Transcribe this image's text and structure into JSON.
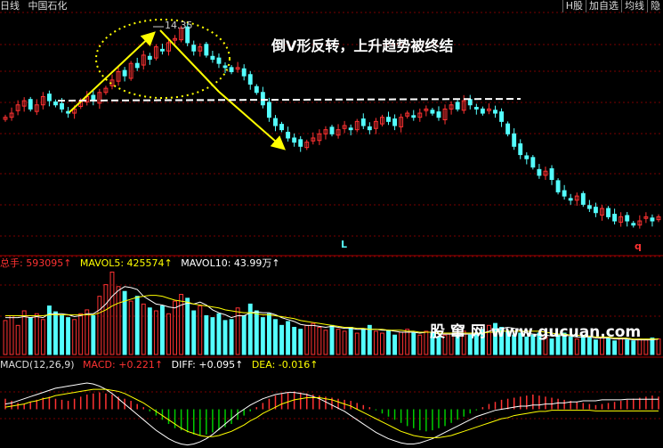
{
  "header": {
    "period": "日线",
    "stock_name": "中国石化"
  },
  "top_buttons": [
    {
      "label": "H股"
    },
    {
      "label": "加自选"
    },
    {
      "label": "均线"
    },
    {
      "label": "隐"
    }
  ],
  "annotation": {
    "title": "倒V形反转，上升趋势被终结",
    "watermark": "股 窜 网 www.gucuan.com",
    "peak_label": "14.35",
    "marker_l": "L",
    "marker_q": "q"
  },
  "volume_legend": {
    "total_label": "总手: 593095↑",
    "mavol5_label": "MAVOL5: 425574↑",
    "mavol10_label": "MAVOL10: 43.99万↑"
  },
  "macd_legend": {
    "params_label": "MACD(12,26,9)",
    "macd_label": "MACD: +0.221↑",
    "diff_label": "DIFF: +0.095↑",
    "dea_label": "DEA: -0.016↑"
  },
  "colors": {
    "up": "#ff3232",
    "down": "#54ffff",
    "grid": "#7a0000",
    "arrow": "#ffff00",
    "dashed_line": "#ffffff",
    "macd_pos": "#ff3232",
    "macd_neg": "#00cc00",
    "diff_line": "#ffffff",
    "dea_line": "#ffff00",
    "mavol5": "#ffffff",
    "mavol10": "#ffff00",
    "accent_label": "#ffff00"
  },
  "chart_data": [
    {
      "type": "candlestick",
      "peak_price": 14.35,
      "close": [
        12.2,
        12.3,
        12.5,
        12.6,
        12.4,
        12.5,
        12.7,
        12.6,
        12.5,
        12.4,
        12.3,
        12.4,
        12.6,
        12.7,
        12.6,
        12.8,
        12.9,
        13.1,
        13.3,
        13.2,
        13.5,
        13.4,
        13.7,
        13.6,
        13.9,
        13.8,
        14.0,
        14.1,
        14.35,
        14.0,
        13.8,
        13.9,
        13.7,
        13.6,
        13.5,
        13.4,
        13.3,
        13.4,
        13.2,
        13.0,
        12.8,
        12.5,
        12.2,
        12.0,
        11.9,
        11.7,
        11.6,
        11.5,
        11.6,
        11.7,
        11.8,
        11.9,
        11.8,
        11.9,
        12.0,
        11.9,
        12.1,
        12.0,
        11.9,
        12.1,
        12.2,
        12.1,
        12.0,
        12.2,
        12.3,
        12.2,
        12.3,
        12.4,
        12.3,
        12.2,
        12.4,
        12.5,
        12.4,
        12.6,
        12.5,
        12.4,
        12.3,
        12.4,
        12.3,
        12.1,
        11.8,
        11.5,
        11.3,
        11.2,
        11.0,
        10.8,
        10.9,
        10.7,
        10.4,
        10.3,
        10.2,
        10.3,
        10.1,
        10.0,
        9.9,
        10.0,
        9.8,
        9.7,
        9.8,
        9.7,
        9.6,
        9.7,
        9.8,
        9.7,
        9.8
      ]
    },
    {
      "type": "bar",
      "title": "总手",
      "values": [
        35,
        40,
        30,
        45,
        38,
        42,
        36,
        50,
        44,
        40,
        38,
        36,
        42,
        46,
        40,
        60,
        72,
        85,
        70,
        65,
        55,
        60,
        52,
        48,
        45,
        50,
        42,
        55,
        62,
        58,
        45,
        50,
        40,
        38,
        42,
        35,
        36,
        48,
        40,
        52,
        45,
        38,
        42,
        36,
        30,
        34,
        28,
        26,
        30,
        32,
        28,
        25,
        30,
        26,
        24,
        28,
        22,
        26,
        30,
        24,
        22,
        25,
        20,
        23,
        26,
        22,
        20,
        24,
        22,
        18,
        20,
        22,
        19,
        24,
        20,
        22,
        26,
        30,
        32,
        28,
        24,
        20,
        22,
        18,
        20,
        22,
        18,
        16,
        20,
        22,
        18,
        16,
        19,
        17,
        15,
        18,
        16,
        14,
        17,
        15,
        14,
        16,
        15,
        17,
        16
      ],
      "series": [
        {
          "name": "MAVOL5",
          "values": [
            38,
            38,
            38,
            39,
            38,
            39,
            38,
            42,
            42,
            42,
            41,
            39,
            40,
            42,
            42,
            46,
            52,
            60,
            66,
            70,
            69,
            67,
            60,
            56,
            52,
            51,
            49,
            48,
            51,
            53,
            52,
            54,
            51,
            46,
            43,
            41,
            38,
            40,
            40,
            43,
            44,
            43,
            43,
            41,
            38,
            36,
            34,
            31,
            30,
            30,
            29,
            28,
            29,
            28,
            27,
            27,
            26,
            26,
            26,
            26,
            25,
            25,
            24,
            23,
            23,
            23,
            22,
            23,
            23,
            21,
            21,
            21,
            20,
            21,
            21,
            21,
            22,
            24,
            26,
            27,
            28,
            27,
            25,
            22,
            21,
            20,
            20,
            19,
            19,
            20,
            19,
            18,
            18,
            18,
            17,
            17,
            17,
            16,
            16,
            16,
            15,
            15,
            15,
            15,
            16
          ]
        },
        {
          "name": "MAVOL10",
          "values": [
            40,
            40,
            40,
            40,
            40,
            40,
            40,
            41,
            41,
            41,
            41,
            41,
            41,
            41,
            41,
            43,
            46,
            50,
            53,
            55,
            57,
            59,
            60,
            61,
            61,
            60,
            58,
            56,
            55,
            54,
            52,
            51,
            50,
            49,
            48,
            46,
            45,
            44,
            43,
            43,
            42,
            41,
            41,
            40,
            39,
            38,
            37,
            35,
            34,
            33,
            32,
            31,
            30,
            29,
            28,
            28,
            27,
            27,
            26,
            26,
            26,
            25,
            25,
            25,
            24,
            24,
            23,
            23,
            23,
            22,
            22,
            22,
            22,
            22,
            22,
            22,
            22,
            23,
            23,
            24,
            24,
            24,
            24,
            24,
            24,
            24,
            23,
            22,
            21,
            21,
            20,
            20,
            19,
            19,
            18,
            18,
            18,
            17,
            17,
            17,
            16,
            16,
            16,
            16,
            16
          ]
        }
      ]
    },
    {
      "type": "line",
      "title": "MACD(12,26,9)",
      "macd_hist": [
        0.1,
        0.08,
        0.06,
        0.05,
        0.07,
        0.09,
        0.11,
        0.12,
        0.1,
        0.09,
        0.08,
        0.1,
        0.12,
        0.14,
        0.15,
        0.16,
        0.15,
        0.14,
        0.12,
        0.1,
        0.08,
        0.05,
        0.02,
        -0.02,
        -0.06,
        -0.1,
        -0.14,
        -0.18,
        -0.2,
        -0.22,
        -0.24,
        -0.25,
        -0.24,
        -0.22,
        -0.2,
        -0.17,
        -0.14,
        -0.1,
        -0.06,
        -0.02,
        0.02,
        0.06,
        0.1,
        0.13,
        0.15,
        0.16,
        0.17,
        0.16,
        0.15,
        0.14,
        0.13,
        0.12,
        0.11,
        0.1,
        0.09,
        0.08,
        0.06,
        0.04,
        0.02,
        -0.01,
        -0.04,
        -0.07,
        -0.1,
        -0.13,
        -0.16,
        -0.18,
        -0.2,
        -0.21,
        -0.2,
        -0.18,
        -0.16,
        -0.13,
        -0.1,
        -0.07,
        -0.04,
        -0.01,
        0.02,
        0.05,
        0.07,
        0.09,
        0.1,
        0.11,
        0.12,
        0.13,
        0.14,
        0.13,
        0.12,
        0.11,
        0.1,
        0.09,
        0.08,
        0.07,
        0.06,
        0.05,
        0.04,
        0.05,
        0.06,
        0.07,
        0.08,
        0.09,
        0.1,
        0.11,
        0.12,
        0.13,
        0.12
      ],
      "series": [
        {
          "name": "DIFF",
          "values": [
            0.05,
            0.06,
            0.08,
            0.1,
            0.12,
            0.14,
            0.16,
            0.18,
            0.2,
            0.21,
            0.22,
            0.23,
            0.24,
            0.25,
            0.24,
            0.22,
            0.19,
            0.15,
            0.1,
            0.05,
            0.0,
            -0.05,
            -0.1,
            -0.15,
            -0.2,
            -0.24,
            -0.28,
            -0.31,
            -0.33,
            -0.34,
            -0.33,
            -0.31,
            -0.28,
            -0.24,
            -0.19,
            -0.14,
            -0.09,
            -0.04,
            0.0,
            0.04,
            0.07,
            0.1,
            0.12,
            0.14,
            0.15,
            0.16,
            0.16,
            0.15,
            0.14,
            0.12,
            0.1,
            0.07,
            0.04,
            0.01,
            -0.02,
            -0.06,
            -0.1,
            -0.14,
            -0.18,
            -0.22,
            -0.25,
            -0.28,
            -0.3,
            -0.32,
            -0.33,
            -0.33,
            -0.32,
            -0.3,
            -0.28,
            -0.25,
            -0.22,
            -0.19,
            -0.16,
            -0.13,
            -0.1,
            -0.07,
            -0.05,
            -0.03,
            -0.01,
            0.0,
            0.01,
            0.02,
            0.03,
            0.03,
            0.04,
            0.04,
            0.05,
            0.05,
            0.06,
            0.06,
            0.07,
            0.07,
            0.08,
            0.08,
            0.08,
            0.09,
            0.09,
            0.09,
            0.09,
            0.095,
            0.095,
            0.095,
            0.095,
            0.095,
            0.095
          ]
        },
        {
          "name": "DEA",
          "values": [
            0.02,
            0.03,
            0.04,
            0.05,
            0.07,
            0.08,
            0.1,
            0.11,
            0.13,
            0.14,
            0.15,
            0.16,
            0.17,
            0.18,
            0.19,
            0.19,
            0.19,
            0.18,
            0.17,
            0.15,
            0.12,
            0.09,
            0.06,
            0.02,
            -0.02,
            -0.06,
            -0.1,
            -0.14,
            -0.18,
            -0.21,
            -0.23,
            -0.25,
            -0.26,
            -0.26,
            -0.25,
            -0.23,
            -0.21,
            -0.18,
            -0.15,
            -0.11,
            -0.08,
            -0.04,
            -0.01,
            0.02,
            0.05,
            0.07,
            0.09,
            0.1,
            0.11,
            0.11,
            0.11,
            0.1,
            0.09,
            0.07,
            0.05,
            0.03,
            0.0,
            -0.03,
            -0.06,
            -0.09,
            -0.12,
            -0.15,
            -0.18,
            -0.21,
            -0.23,
            -0.25,
            -0.26,
            -0.27,
            -0.27,
            -0.27,
            -0.26,
            -0.25,
            -0.23,
            -0.21,
            -0.19,
            -0.17,
            -0.15,
            -0.13,
            -0.11,
            -0.09,
            -0.08,
            -0.06,
            -0.05,
            -0.04,
            -0.03,
            -0.02,
            -0.02,
            -0.01,
            -0.01,
            -0.01,
            -0.01,
            -0.01,
            -0.01,
            -0.01,
            -0.016,
            -0.016,
            -0.016,
            -0.016,
            -0.016,
            -0.016,
            -0.016,
            -0.016,
            -0.016,
            -0.016,
            -0.016
          ]
        }
      ]
    }
  ]
}
